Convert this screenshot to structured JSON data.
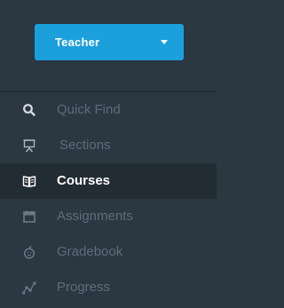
{
  "role_selector": {
    "value": "Teacher",
    "color": "#1ba0dc"
  },
  "nav": {
    "items": [
      {
        "label": "Quick Find",
        "icon": "search-icon",
        "active": false
      },
      {
        "label": "Sections",
        "icon": "easel-icon",
        "active": false
      },
      {
        "label": "Courses",
        "icon": "book-icon",
        "active": true
      },
      {
        "label": "Assignments",
        "icon": "calendar-icon",
        "active": false
      },
      {
        "label": "Gradebook",
        "icon": "apple-icon",
        "active": false
      },
      {
        "label": "Progress",
        "icon": "line-chart-icon",
        "active": false
      }
    ]
  },
  "colors": {
    "sidebar_bg": "#2b3741",
    "active_bg": "#222c33",
    "muted_text": "#5d6d79",
    "active_text": "#ffffff"
  }
}
